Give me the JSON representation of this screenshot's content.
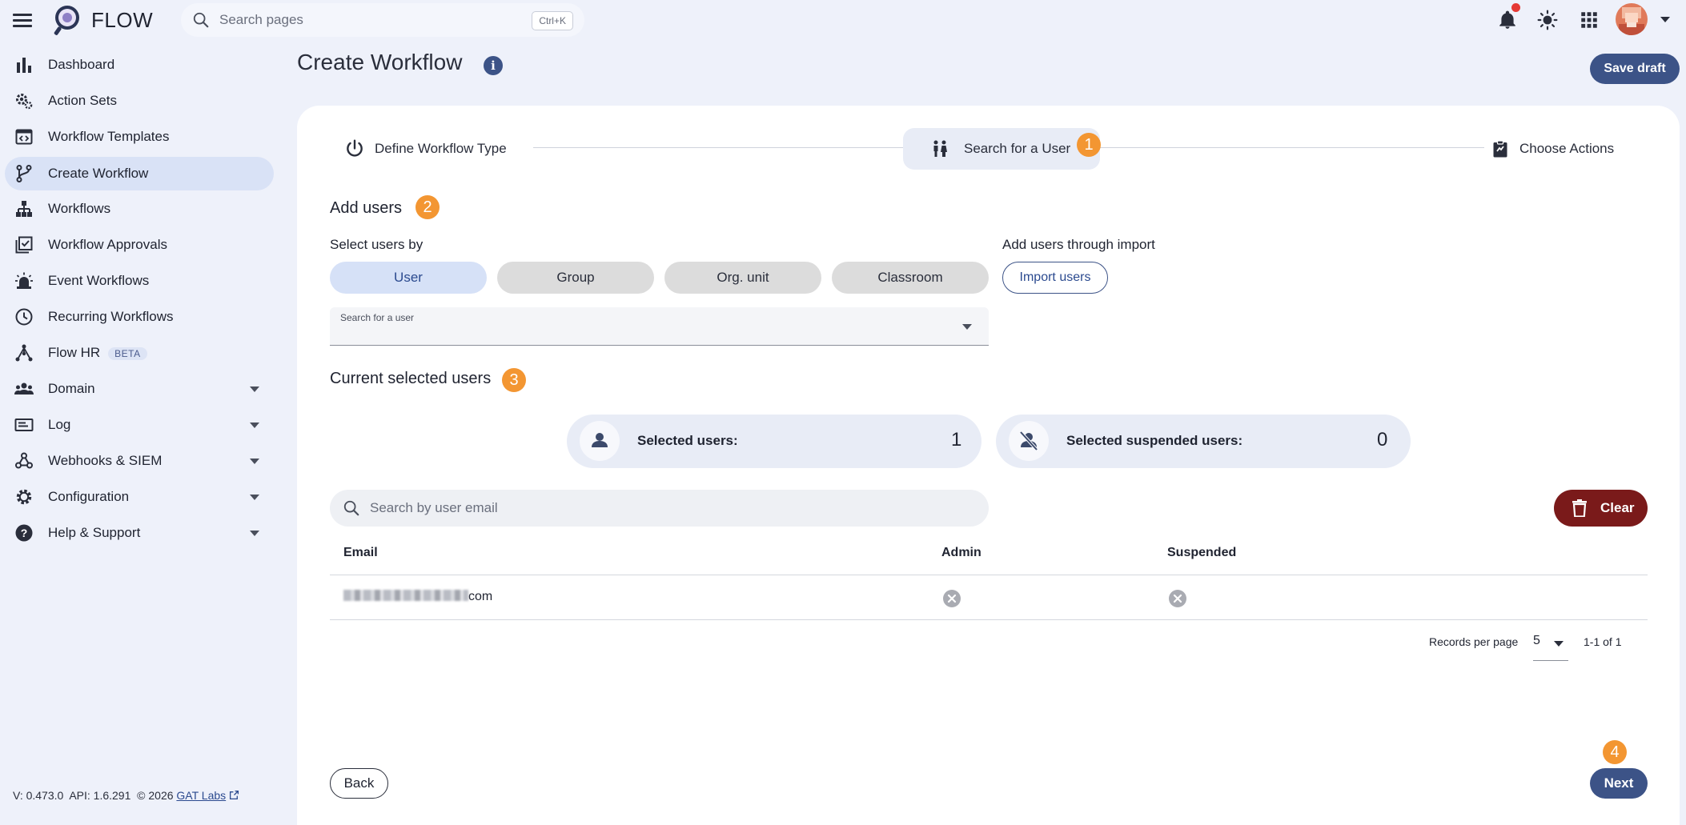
{
  "app": {
    "name": "FLOW",
    "search_placeholder": "Search pages",
    "search_shortcut": "Ctrl+K"
  },
  "sidebar": {
    "items": [
      {
        "label": "Dashboard",
        "icon": "bar-chart-icon"
      },
      {
        "label": "Action Sets",
        "icon": "gears-icon"
      },
      {
        "label": "Workflow Templates",
        "icon": "code-window-icon"
      },
      {
        "label": "Create Workflow",
        "icon": "branch-icon",
        "active": true
      },
      {
        "label": "Workflows",
        "icon": "hierarchy-icon"
      },
      {
        "label": "Workflow Approvals",
        "icon": "checklist-icon"
      },
      {
        "label": "Event Workflows",
        "icon": "alarm-light-icon"
      },
      {
        "label": "Recurring Workflows",
        "icon": "clock-icon"
      },
      {
        "label": "Flow HR",
        "icon": "people-tree-icon",
        "badge": "BETA"
      },
      {
        "label": "Domain",
        "icon": "group-icon",
        "expandable": true
      },
      {
        "label": "Log",
        "icon": "log-icon",
        "expandable": true
      },
      {
        "label": "Webhooks & SIEM",
        "icon": "webhook-icon",
        "expandable": true
      },
      {
        "label": "Configuration",
        "icon": "gear-icon",
        "expandable": true
      },
      {
        "label": "Help & Support",
        "icon": "help-icon",
        "expandable": true
      }
    ]
  },
  "footer": {
    "version": "V: 0.473.0",
    "api": "API: 1.6.291",
    "copyright": "© 2026",
    "company_link": "GAT Labs"
  },
  "page": {
    "title": "Create Workflow",
    "save_draft": "Save draft"
  },
  "stepper": {
    "steps": [
      {
        "label": "Define Workflow Type",
        "active": false
      },
      {
        "label": "Search for a User",
        "active": true,
        "badge": "1"
      },
      {
        "label": "Choose Actions",
        "active": false
      }
    ]
  },
  "add_users": {
    "title": "Add users",
    "badge": "2",
    "select_by_label": "Select users by",
    "options": [
      "User",
      "Group",
      "Org. unit",
      "Classroom"
    ],
    "selected_option": "User",
    "import_label": "Add users through import",
    "import_button": "Import users",
    "search_user_label": "Search for a user"
  },
  "current_users": {
    "title": "Current selected users",
    "badge": "3",
    "selected_label": "Selected users:",
    "selected_count": "1",
    "suspended_label": "Selected suspended users:",
    "suspended_count": "0",
    "email_search_placeholder": "Search by user email",
    "clear_button": "Clear",
    "columns": [
      "Email",
      "Admin",
      "Suspended"
    ],
    "rows": [
      {
        "email_suffix": "com",
        "admin": false,
        "suspended": false
      }
    ],
    "records_per_page_label": "Records per page",
    "records_per_page": "5",
    "range": "1-1 of 1"
  },
  "actions": {
    "back": "Back",
    "next": "Next",
    "next_badge": "4"
  },
  "colors": {
    "primary": "#3c5387",
    "accent_badge": "#f39632",
    "danger": "#7a1a1a",
    "background": "#eef1fa"
  }
}
